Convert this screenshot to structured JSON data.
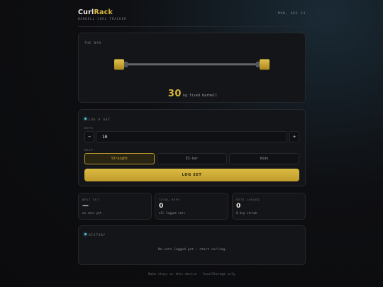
{
  "header": {
    "brand_part1": "Curl",
    "brand_part2": "Rack",
    "subtitle": "BARBELL CURL TRACKER",
    "date": "MON, AUG 24"
  },
  "bar": {
    "section_label": "THE BAR",
    "weight": "30",
    "unit_text": "kg fixed barbell"
  },
  "log": {
    "section_label": "LOG A SET",
    "reps_label": "REPS",
    "reps_value": "10",
    "minus_label": "−",
    "plus_label": "+",
    "grip_label": "GRIP",
    "grips": [
      "Straight",
      "EZ-bar",
      "Wide"
    ],
    "selected_grip": "Straight",
    "submit_label": "LOG SET"
  },
  "stats": [
    {
      "key": "BEST SET",
      "value": "—",
      "sub": "no sets yet"
    },
    {
      "key": "TOTAL REPS",
      "value": "0",
      "sub": "all logged sets"
    },
    {
      "key": "SETS LOGGED",
      "value": "0",
      "sub": "0 day streak"
    }
  ],
  "history": {
    "section_label": "HISTORY",
    "empty_text": "No sets logged yet — start curling."
  },
  "footer": "Data stays on this device · localStorage only",
  "colors": {
    "accent": "#d8b53c",
    "indicator": "#4fc7d8",
    "background": "#0e0f12",
    "card": "#141518"
  }
}
